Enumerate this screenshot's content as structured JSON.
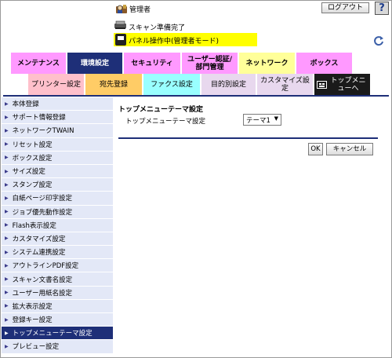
{
  "header": {
    "admin_label": "管理者",
    "logout_label": "ログアウト",
    "help_label": "?",
    "status_label": "スキャン準備完了",
    "panel_status": "パネル操作中(管理者モード)",
    "refresh_icon": "refresh-icon"
  },
  "main_tabs": [
    {
      "label": "メンテナンス",
      "color": "#ff99ff"
    },
    {
      "label": "環境設定",
      "color": "#1e2f78",
      "active": true
    },
    {
      "label": "セキュリティ",
      "color": "#ff99ff"
    },
    {
      "label": "ユーザー認証/部門管理",
      "color": "#ff99ff"
    },
    {
      "label": "ネットワーク",
      "color": "#ffff99"
    },
    {
      "label": "ボックス",
      "color": "#ff99ff"
    }
  ],
  "sub_tabs": [
    {
      "label": "プリンター設定",
      "color": "#ffc0cb"
    },
    {
      "label": "宛先登録",
      "color": "#ffcc66"
    },
    {
      "label": "ファクス設定",
      "color": "#99ffff"
    },
    {
      "label": "目的別設定",
      "color": "#e8d8ee"
    },
    {
      "label": "カスタマイズ設定",
      "color": "#e8d8ee"
    },
    {
      "label": "トップメニューへ",
      "color": "#1a1a1a",
      "icon": "home-menu-icon"
    }
  ],
  "sidebar": {
    "items": [
      {
        "label": "本体登録"
      },
      {
        "label": "サポート情報登録"
      },
      {
        "label": "ネットワークTWAIN"
      },
      {
        "label": "リセット設定"
      },
      {
        "label": "ボックス設定"
      },
      {
        "label": "サイズ設定"
      },
      {
        "label": "スタンプ設定"
      },
      {
        "label": "白紙ページ印字設定"
      },
      {
        "label": "ジョブ優先動作設定"
      },
      {
        "label": "Flash表示設定"
      },
      {
        "label": "カスタマイズ設定"
      },
      {
        "label": "システム連携設定"
      },
      {
        "label": "アウトラインPDF設定"
      },
      {
        "label": "スキャン文書名設定"
      },
      {
        "label": "ユーザー用紙名設定"
      },
      {
        "label": "拡大表示設定"
      },
      {
        "label": "登録キー設定"
      },
      {
        "label": "トップメニューテーマ設定",
        "active": true
      },
      {
        "label": "プレビュー設定"
      }
    ]
  },
  "main": {
    "title": "トップメニューテーマ設定",
    "field_label": "トップメニューテーマ設定",
    "select_value": "テーマ1",
    "ok_label": "OK",
    "cancel_label": "キャンセル"
  },
  "colors": {
    "accent": "#1e2f78",
    "sidebar_bg": "#e3e8f7",
    "panel_yellow": "#ffff00"
  }
}
